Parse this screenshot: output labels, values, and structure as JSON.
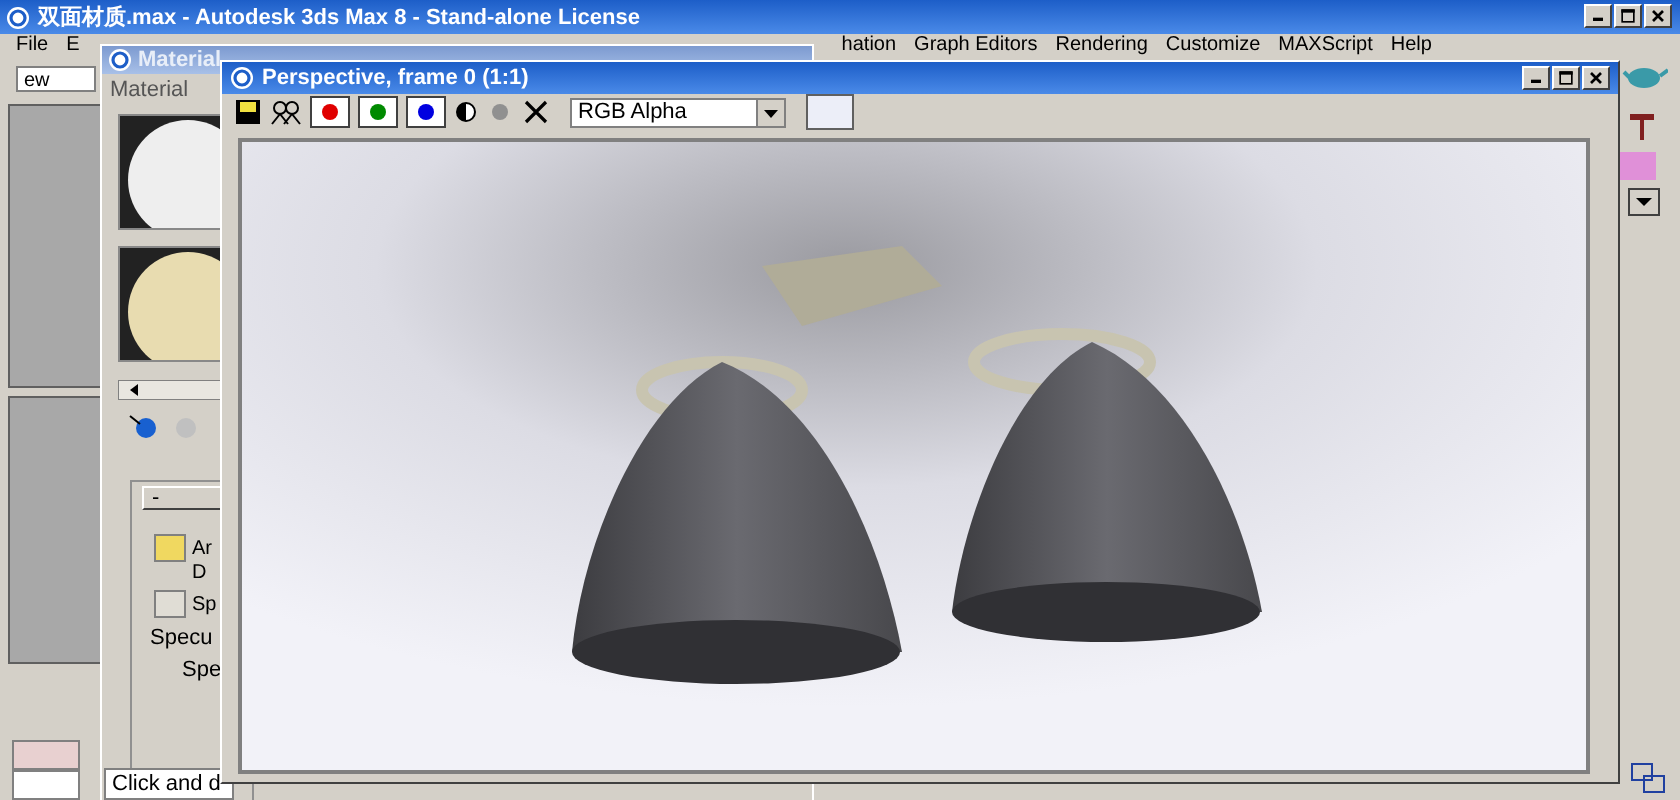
{
  "main_window": {
    "title": "双面材质.max - Autodesk 3ds Max 8  - Stand-alone License",
    "menu": [
      "File",
      "E",
      "hation",
      "Graph Editors",
      "Rendering",
      "Customize",
      "MAXScript",
      "Help"
    ]
  },
  "viewport_field": "ew",
  "material_editor": {
    "title": "Material",
    "menu": [
      "Material"
    ],
    "rollout_toggle": "-",
    "rows": [
      "Ar",
      "D",
      "Sp"
    ],
    "group_label": "Specu",
    "group_row": "Spe"
  },
  "status": {
    "prompt": "Click and d"
  },
  "render_window": {
    "title": "Perspective, frame 0 (1:1)",
    "channels": [
      {
        "color": "#e00000",
        "on": true
      },
      {
        "color": "#008a00",
        "on": true
      },
      {
        "color": "#0000e0",
        "on": true
      }
    ],
    "channel_dropdown": "RGB Alpha"
  }
}
